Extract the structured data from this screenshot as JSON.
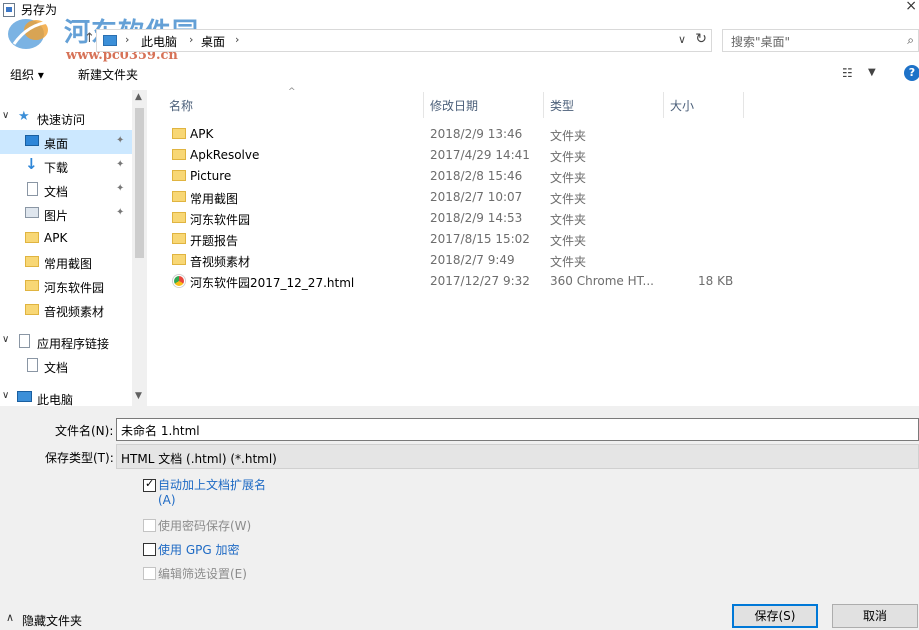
{
  "window": {
    "title": "另存为"
  },
  "watermark": {
    "site": "河东软件园",
    "url": "www.pc0359.cn"
  },
  "address": {
    "segments": [
      "此电脑",
      "桌面"
    ],
    "search_placeholder": "搜索\"桌面\""
  },
  "toolbar": {
    "organize": "组织 ▾",
    "new_folder": "新建文件夹"
  },
  "navigation": {
    "items": [
      {
        "label": "快速访问",
        "icon": "star-icon",
        "expander": "∨"
      },
      {
        "label": "桌面",
        "icon": "desktop-icon",
        "pinned": true,
        "selected": true
      },
      {
        "label": "下载",
        "icon": "download-icon",
        "pinned": true
      },
      {
        "label": "文档",
        "icon": "document-icon",
        "pinned": true
      },
      {
        "label": "图片",
        "icon": "picture-icon",
        "pinned": true
      },
      {
        "label": "APK",
        "icon": "folder-icon"
      },
      {
        "label": "常用截图",
        "icon": "folder-icon"
      },
      {
        "label": "河东软件园",
        "icon": "folder-icon"
      },
      {
        "label": "音视频素材",
        "icon": "folder-icon"
      },
      {
        "label": "应用程序链接",
        "icon": "link-icon",
        "expander": "∨"
      },
      {
        "label": "文档",
        "icon": "document-icon"
      },
      {
        "label": "此电脑",
        "icon": "pc-icon",
        "expander": "∨"
      }
    ]
  },
  "columns": {
    "name": "名称",
    "modified": "修改日期",
    "type": "类型",
    "size": "大小"
  },
  "files": [
    {
      "name": "APK",
      "modified": "2018/2/9 13:46",
      "type": "文件夹",
      "size": "",
      "icon": "folder-icon"
    },
    {
      "name": "ApkResolve",
      "modified": "2017/4/29 14:41",
      "type": "文件夹",
      "size": "",
      "icon": "folder-icon"
    },
    {
      "name": "Picture",
      "modified": "2018/2/8 15:46",
      "type": "文件夹",
      "size": "",
      "icon": "folder-icon"
    },
    {
      "name": "常用截图",
      "modified": "2018/2/7 10:07",
      "type": "文件夹",
      "size": "",
      "icon": "folder-icon"
    },
    {
      "name": "河东软件园",
      "modified": "2018/2/9 14:53",
      "type": "文件夹",
      "size": "",
      "icon": "folder-icon"
    },
    {
      "name": "开题报告",
      "modified": "2017/8/15 15:02",
      "type": "文件夹",
      "size": "",
      "icon": "folder-icon"
    },
    {
      "name": "音视频素材",
      "modified": "2018/2/7 9:49",
      "type": "文件夹",
      "size": "",
      "icon": "folder-icon"
    },
    {
      "name": "河东软件园2017_12_27.html",
      "modified": "2017/12/27 9:32",
      "type": "360 Chrome HT...",
      "size": "18 KB",
      "icon": "html-file-icon"
    }
  ],
  "form": {
    "filename_label": "文件名(N):",
    "filename_value": "未命名 1.html",
    "filetype_label": "保存类型(T):",
    "filetype_value": "HTML 文档 (.html) (*.html)",
    "options": [
      {
        "label": "自动加上文档扩展名",
        "label2": "(A)",
        "checked": true,
        "enabled": true
      },
      {
        "label": "使用密码保存(W)",
        "checked": false,
        "enabled": false
      },
      {
        "label": "使用 GPG 加密",
        "checked": false,
        "enabled": true
      },
      {
        "label": "编辑筛选设置(E)",
        "checked": false,
        "enabled": false
      }
    ]
  },
  "footer": {
    "hide_folders": "隐藏文件夹",
    "save": "保存(S)",
    "cancel": "取消"
  },
  "colors": {
    "accent": "#0078d7",
    "selection": "#cce8ff",
    "folder": "#f8d775",
    "link_blue": "#1e6ac4"
  }
}
